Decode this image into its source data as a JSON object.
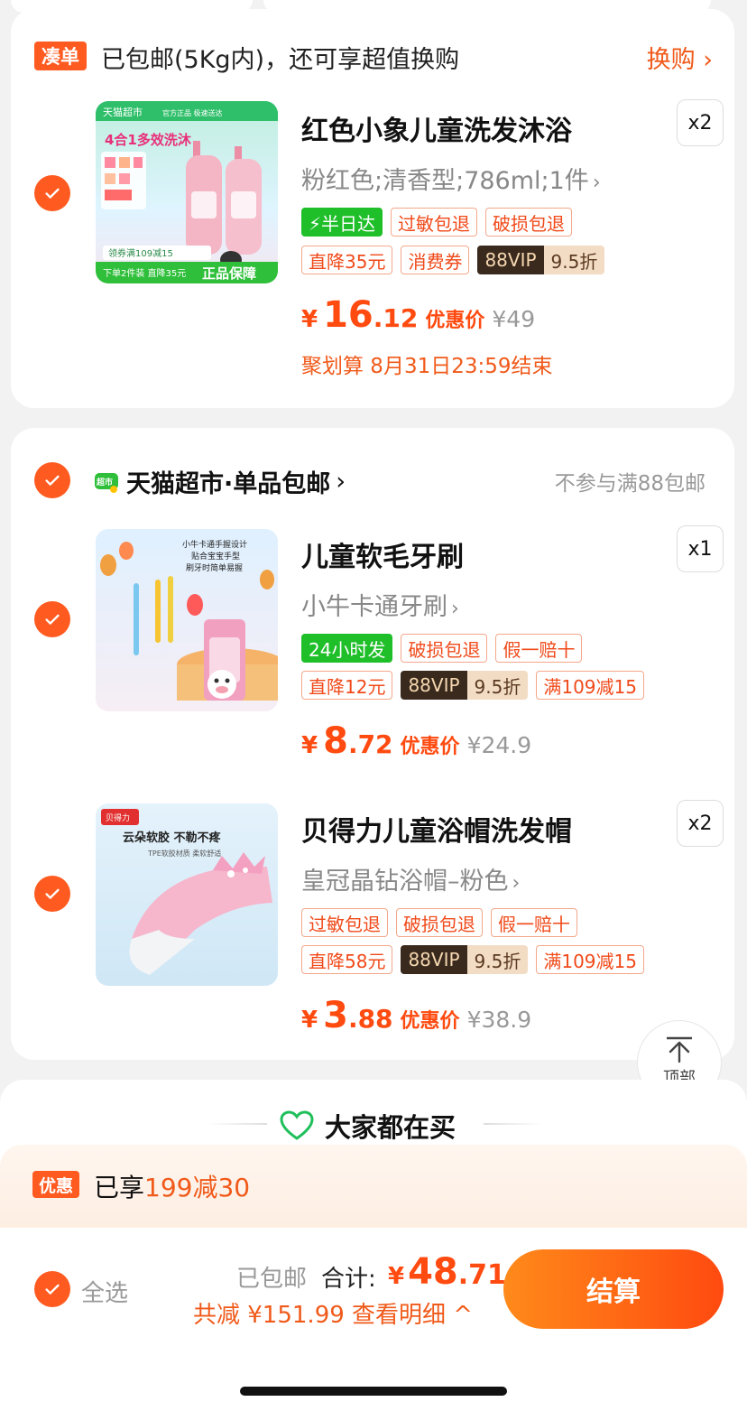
{
  "bundle": {
    "badge": "凑单",
    "text": "已包邮(5Kg内)，还可享超值换购",
    "action": "换购 ›"
  },
  "items": [
    {
      "title": "红色小象儿童洗发沐浴",
      "spec": "粉红色;清香型;786ml;1件",
      "qty": "x2",
      "tags_row1": [
        "⚡半日达",
        "过敏包退",
        "破损包退"
      ],
      "tags_row2": [
        "直降35元",
        "消费券"
      ],
      "vip": "88VIP",
      "vip_discount": "9.5折",
      "price_currency": "¥",
      "price_int": "16",
      "price_dec": ".12",
      "price_label": "优惠价",
      "orig_price": "¥49",
      "juhuasuan": "聚划算 8月31日23:59结束",
      "thumb_text": {
        "brand": "天猫超市",
        "slogan": "官方正品 极速送达",
        "headline": "4合1多效洗沐",
        "coupon": "领券满109减15",
        "deal": "下单2件装 直降35元",
        "guarantee": "正品保障"
      }
    },
    {
      "title": "儿童软毛牙刷",
      "spec": "小牛卡通牙刷",
      "qty": "x1",
      "tags_row1": [
        "24小时发",
        "破损包退",
        "假一赔十"
      ],
      "tags_row2": [
        "直降12元"
      ],
      "vip": "88VIP",
      "vip_discount": "9.5折",
      "tags_row2_after": [
        "满109减15"
      ],
      "price_currency": "¥",
      "price_int": "8",
      "price_dec": ".72",
      "price_label": "优惠价",
      "orig_price": "¥24.9",
      "thumb_text": {
        "line1": "小牛卡通手握设计",
        "line2": "贴合宝宝手型",
        "line3": "刷牙时简单易握"
      }
    },
    {
      "title": "贝得力儿童浴帽洗发帽",
      "spec": "皇冠晶钻浴帽–粉色",
      "qty": "x2",
      "tags_row1": [
        "过敏包退",
        "破损包退",
        "假一赔十"
      ],
      "tags_row2": [
        "直降58元"
      ],
      "vip": "88VIP",
      "vip_discount": "9.5折",
      "tags_row2_after": [
        "满109减15"
      ],
      "price_currency": "¥",
      "price_int": "3",
      "price_dec": ".88",
      "price_label": "优惠价",
      "orig_price": "¥38.9",
      "thumb_text": {
        "brand": "贝得力",
        "headline": "云朵软胶 不勒不疼",
        "sub": "TPE软胶材质 柔软舒适"
      }
    }
  ],
  "store": {
    "icon_label": "超市",
    "name": "天猫超市·单品包邮",
    "note": "不参与满88包邮"
  },
  "to_top": "顶部",
  "recommend_title": "大家都在买",
  "promo": {
    "badge": "优惠",
    "prefix": "已享",
    "highlight": "199减30"
  },
  "footer": {
    "select_all": "全选",
    "shipped": "已包邮",
    "total_label": "合计:",
    "total_currency": "¥",
    "total_int": "48",
    "total_dec": ".71",
    "saving": "共减 ¥151.99  查看明细 ^",
    "checkout": "结算"
  },
  "colors": {
    "accent": "#ff5a1f",
    "price": "#ff4a10",
    "green": "#1fbf2a"
  }
}
